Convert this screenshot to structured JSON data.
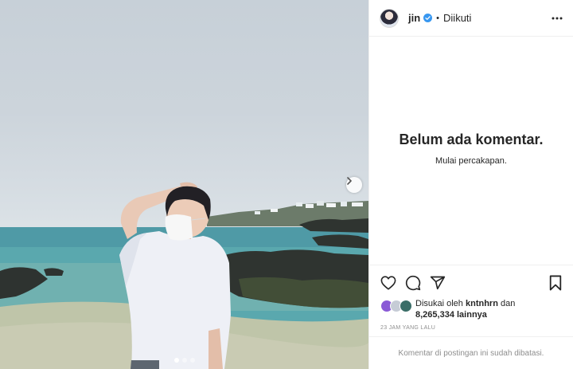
{
  "post": {
    "photo_description_icon": "photo",
    "carousel": {
      "dots": 3,
      "active_index": 0
    }
  },
  "header": {
    "username": "jin",
    "separator": "•",
    "follow_state": "Diikuti",
    "verified_icon": "verified-badge",
    "more_icon": "more-horizontal"
  },
  "comments": {
    "empty_title": "Belum ada komentar.",
    "empty_subtitle": "Mulai percakapan."
  },
  "actions": {
    "like_icon": "heart-outline",
    "comment_icon": "speech-bubble",
    "share_icon": "paper-plane",
    "save_icon": "bookmark"
  },
  "likes": {
    "prefix": "Disukai oleh ",
    "first_user": "kntnhrn",
    "conjunction": " dan",
    "count": "8,265,334",
    "suffix": " lainnya"
  },
  "timestamp": "23 JAM YANG LALU",
  "footer": {
    "comments_disabled": "Komentar di postingan ini sudah dibatasi."
  },
  "colors": {
    "verified": "#3897f0",
    "border": "#efefef",
    "muted": "#8e8e8e"
  }
}
